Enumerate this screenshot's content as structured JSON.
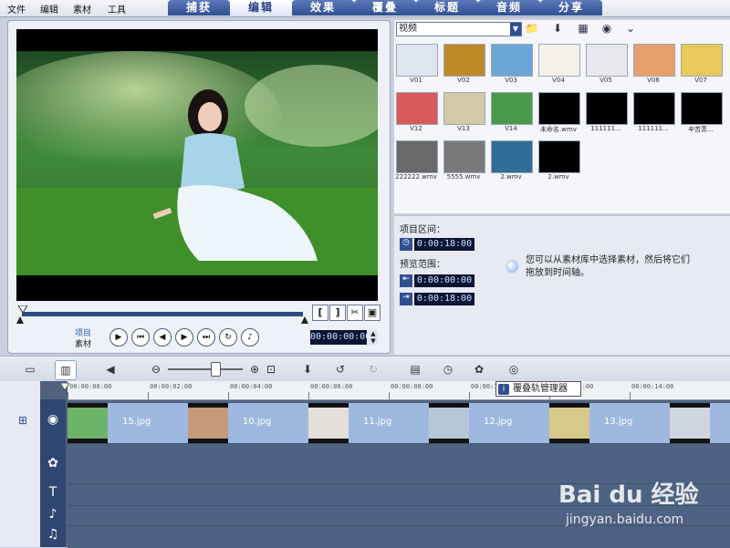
{
  "menu": [
    "文件",
    "编辑",
    "素材",
    "工具"
  ],
  "tabs": [
    {
      "label": "捕获",
      "active": false
    },
    {
      "label": "编辑",
      "active": true
    },
    {
      "label": "效果",
      "active": false
    },
    {
      "label": "覆叠",
      "active": false
    },
    {
      "label": "标题",
      "active": false
    },
    {
      "label": "音频",
      "active": false
    },
    {
      "label": "分享",
      "active": false
    }
  ],
  "preview": {
    "mode_project": "项目",
    "mode_clip": "素材",
    "timecode": "00:00:00:00",
    "mark_in": "[",
    "mark_out": "]"
  },
  "library": {
    "category": "视频",
    "thumbs": [
      {
        "label": "V01",
        "color": "#dfe6ef"
      },
      {
        "label": "V02",
        "color": "#c08a2a"
      },
      {
        "label": "V03",
        "color": "#6aa6d8"
      },
      {
        "label": "V04",
        "color": "#f3f1ea"
      },
      {
        "label": "V05",
        "color": "#e8e8ec"
      },
      {
        "label": "V06",
        "color": "#e8a06a"
      },
      {
        "label": "V07",
        "color": "#e9c95a"
      },
      {
        "label": "V12",
        "color": "#d85a5a"
      },
      {
        "label": "V13",
        "color": "#d6c9a8"
      },
      {
        "label": "V14",
        "color": "#4a9a4a"
      },
      {
        "label": "未命名.wmv",
        "color": "#000000"
      },
      {
        "label": "111111...",
        "color": "#000000"
      },
      {
        "label": "111111...",
        "color": "#000000"
      },
      {
        "label": "辛苦蒸...",
        "color": "#000000"
      },
      {
        "label": "222222.wmv",
        "color": "#6a6a6a"
      },
      {
        "label": "5555.wmv",
        "color": "#7a7a7a"
      },
      {
        "label": "2.wmv",
        "color": "#2f6e96"
      },
      {
        "label": "2.wmv",
        "color": "#000000"
      }
    ]
  },
  "info": {
    "project_duration_label": "项目区间：",
    "project_duration": "0:00:18:00",
    "preview_range_label": "预览范围：",
    "range_start": "0:00:00:00",
    "range_end": "0:00:18:00",
    "hint": "您可以从素材库中选择素材，然后将它们拖放到时间轴。"
  },
  "timeline": {
    "ruler": [
      "00:00:00:00",
      "00:00:02:00",
      "00:00:04:00",
      "00:00:06:00",
      "00:00:08:00",
      "00:00:10:00",
      "00:00:12:00",
      "00:00:14:00"
    ],
    "overlay_tip": "覆叠轨管理器",
    "clips": [
      {
        "label": "15.jpg",
        "thumb": "#6db36a"
      },
      {
        "label": "10.jpg",
        "thumb": "#c49a7a"
      },
      {
        "label": "11.jpg",
        "thumb": "#e5e0da"
      },
      {
        "label": "12.jpg",
        "thumb": "#b6c8d8"
      },
      {
        "label": "13.jpg",
        "thumb": "#d8c88a"
      },
      {
        "label": "",
        "thumb": "#cfd6df"
      }
    ]
  },
  "watermark": {
    "brand": "Bai du 经验",
    "url": "jingyan.baidu.com"
  }
}
